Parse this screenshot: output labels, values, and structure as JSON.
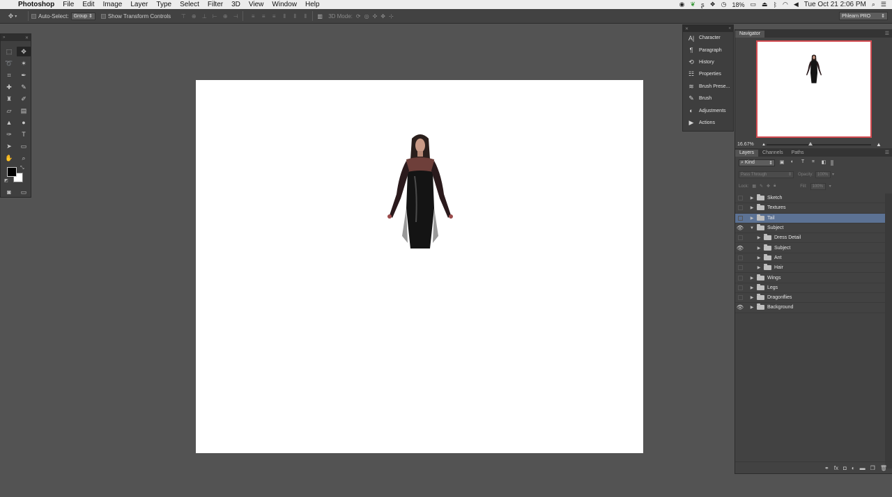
{
  "menubar": {
    "app_name": "Photoshop",
    "items": [
      "File",
      "Edit",
      "Image",
      "Layer",
      "Type",
      "Select",
      "Filter",
      "3D",
      "View",
      "Window",
      "Help"
    ],
    "battery": "18%",
    "clock": "Tue Oct 21  2:06 PM"
  },
  "options": {
    "auto_select_label": "Auto-Select:",
    "auto_select_value": "Group",
    "show_transform_label": "Show Transform Controls",
    "mode_3d_label": "3D Mode:",
    "workspace": "Phlearn PRO"
  },
  "dock": {
    "items": [
      {
        "label": "Character",
        "icon": "A|"
      },
      {
        "label": "Paragraph",
        "icon": "¶"
      },
      {
        "label": "History",
        "icon": "⟲"
      },
      {
        "label": "Properties",
        "icon": "☷"
      },
      {
        "label": "Brush Prese...",
        "icon": "≋"
      },
      {
        "label": "Brush",
        "icon": "✎"
      },
      {
        "label": "Adjustments",
        "icon": "◐"
      },
      {
        "label": "Actions",
        "icon": "▶"
      }
    ]
  },
  "navigator": {
    "tab": "Navigator",
    "zoom": "16.67%"
  },
  "layers_panel": {
    "tabs": [
      "Layers",
      "Channels",
      "Paths"
    ],
    "kind_label": "Kind",
    "blend_mode": "Pass Through",
    "opacity_label": "Opacity:",
    "opacity_value": "100%",
    "lock_label": "Lock:",
    "fill_label": "Fill:",
    "fill_value": "100%",
    "layers": [
      {
        "name": "Sketch",
        "visible": false,
        "indent": 0,
        "expanded": false,
        "selected": false
      },
      {
        "name": "Textures",
        "visible": false,
        "indent": 0,
        "expanded": false,
        "selected": false
      },
      {
        "name": "Tail",
        "visible": false,
        "indent": 0,
        "expanded": false,
        "selected": true
      },
      {
        "name": "Subject",
        "visible": true,
        "indent": 0,
        "expanded": true,
        "selected": false
      },
      {
        "name": "Dress Detail",
        "visible": false,
        "indent": 1,
        "expanded": false,
        "selected": false
      },
      {
        "name": "Subject",
        "visible": true,
        "indent": 1,
        "expanded": false,
        "selected": false
      },
      {
        "name": "Ant",
        "visible": false,
        "indent": 1,
        "expanded": false,
        "selected": false
      },
      {
        "name": "Hair",
        "visible": false,
        "indent": 1,
        "expanded": false,
        "selected": false
      },
      {
        "name": "Wings",
        "visible": false,
        "indent": 0,
        "expanded": false,
        "selected": false
      },
      {
        "name": "Legs",
        "visible": false,
        "indent": 0,
        "expanded": false,
        "selected": false
      },
      {
        "name": "Dragonflies",
        "visible": false,
        "indent": 0,
        "expanded": false,
        "selected": false
      },
      {
        "name": "Background",
        "visible": true,
        "indent": 0,
        "expanded": false,
        "selected": false
      }
    ]
  },
  "colors": {
    "selection": "#5c7294",
    "nav_frame": "#d24a50"
  }
}
